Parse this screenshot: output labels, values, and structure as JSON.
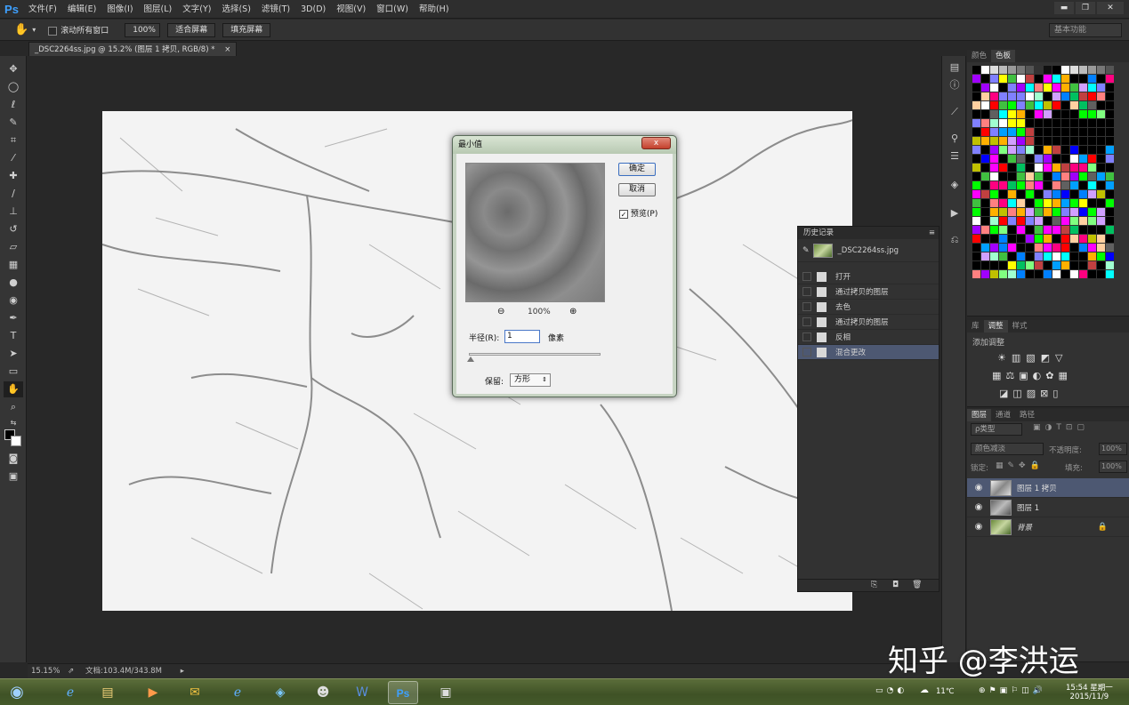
{
  "app": {
    "logo": "Ps"
  },
  "menu": [
    "文件(F)",
    "编辑(E)",
    "图像(I)",
    "图层(L)",
    "文字(Y)",
    "选择(S)",
    "滤镜(T)",
    "3D(D)",
    "视图(V)",
    "窗口(W)",
    "帮助(H)"
  ],
  "options": {
    "scroll_all": "滚动所有窗口",
    "zoom": "100%",
    "fit_screen": "适合屏幕",
    "fill_screen": "填充屏幕",
    "workspace": "基本功能"
  },
  "document": {
    "tab": "_DSC2264ss.jpg @ 15.2% (图层 1 拷贝, RGB/8) *",
    "tab_close": "×"
  },
  "status": {
    "zoom": "15.15%",
    "doc_size": "文档:103.4M/343.8M"
  },
  "dialog": {
    "title": "最小值",
    "close": "x",
    "ok": "确定",
    "cancel": "取消",
    "preview_label": "预览(P)",
    "preview_checked": true,
    "zoom_level": "100%",
    "radius_label": "半径(R):",
    "radius_value": "1",
    "radius_unit": "像素",
    "preserve_label": "保留:",
    "preserve_value": "方形"
  },
  "history": {
    "tab": "历史记录",
    "snapshot": "_DSC2264ss.jpg",
    "items": [
      "打开",
      "通过拷贝的图层",
      "去色",
      "通过拷贝的图层",
      "反相",
      "混合更改"
    ],
    "selected_index": 5
  },
  "swatches": {
    "tabs": [
      "颜色",
      "色板"
    ]
  },
  "adjustments": {
    "tabs": [
      "库",
      "调整",
      "样式"
    ],
    "title": "添加调整"
  },
  "layers": {
    "tabs": [
      "图层",
      "通道",
      "路径"
    ],
    "filter": "ρ类型",
    "blend_mode": "颜色减淡",
    "opacity_label": "不透明度:",
    "opacity": "100%",
    "lock_label": "锁定:",
    "fill_label": "填充:",
    "fill": "100%",
    "items": [
      {
        "name": "图层 1 拷贝",
        "selected": true
      },
      {
        "name": "图层 1",
        "selected": false
      },
      {
        "name": "背景",
        "selected": false
      }
    ]
  },
  "taskbar": {
    "temp": "11℃",
    "time": "15:54 星期一",
    "date": "2015/11/9"
  },
  "watermark": "知乎 @李洪运"
}
